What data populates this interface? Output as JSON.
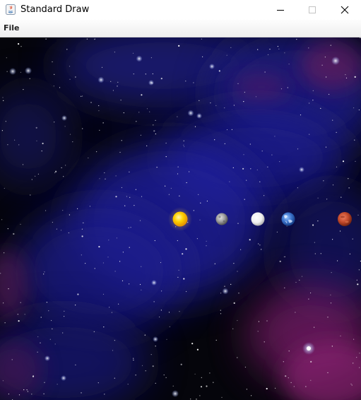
{
  "window": {
    "title": "Standard Draw",
    "icons": {
      "app": "java-icon",
      "minimize": "minimize-icon",
      "maximize": "maximize-icon",
      "close": "close-icon"
    }
  },
  "menu": {
    "items": [
      "File"
    ]
  },
  "canvas": {
    "background": "#05050b",
    "nebula_colors": [
      "#1a1a8c",
      "#2a2ab0",
      "#7a1a6a",
      "#b0306a"
    ],
    "bodies": [
      {
        "name": "sun",
        "icon": "sun-icon",
        "color": "#ffd000"
      },
      {
        "name": "mercury",
        "icon": "mercury-icon",
        "color": "#9a9a9a"
      },
      {
        "name": "venus",
        "icon": "venus-icon",
        "color": "#f0f0f0"
      },
      {
        "name": "earth",
        "icon": "earth-icon",
        "color": "#3a70c8"
      },
      {
        "name": "mars",
        "icon": "mars-icon",
        "color": "#c0482a"
      }
    ]
  }
}
